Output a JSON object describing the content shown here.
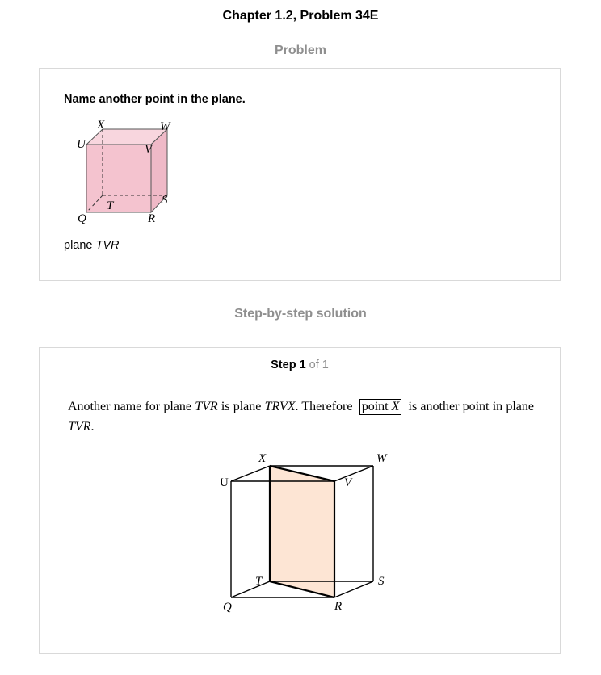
{
  "header": {
    "chapter_title": "Chapter 1.2, Problem 34E"
  },
  "problem_section": {
    "heading": "Problem",
    "prompt": "Name another point in the plane.",
    "caption_prefix": "plane ",
    "caption_plane": "TVR",
    "figure_labels": {
      "x": "X",
      "w": "W",
      "u": "U",
      "v": "V",
      "t": "T",
      "s": "S",
      "q": "Q",
      "r": "R"
    },
    "figure_fill_color": "#f4c3cf"
  },
  "solution_section": {
    "heading": "Step-by-step solution",
    "step_word": "Step 1",
    "step_of": "of 1",
    "text_part1": "Another name for plane ",
    "text_plane1": "TVR",
    "text_part2": " is plane ",
    "text_plane2": "TRVX",
    "text_part3": ". Therefore ",
    "answer_prefix": "point ",
    "answer_point": "X",
    "text_part4": " is another point in plane ",
    "text_plane3": "TVR",
    "text_part5": ".",
    "figure_labels": {
      "x": "X",
      "w": "W",
      "u": "U",
      "v": "V",
      "t": "T",
      "s": "S",
      "q": "Q",
      "r": "R"
    },
    "figure_fill_color": "#fde5d4"
  }
}
